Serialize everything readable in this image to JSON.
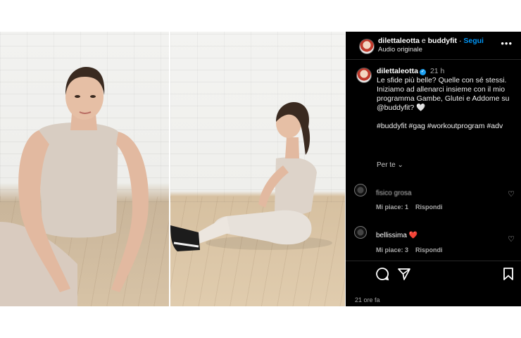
{
  "header": {
    "user1": "dilettaleotta",
    "conj": "e",
    "user2": "buddyfit",
    "sep": "·",
    "follow": "Segui",
    "audio": "Audio originale",
    "more_icon": "more-icon"
  },
  "caption": {
    "username": "dilettaleotta",
    "time": "21 h",
    "line1": "Le sfide più belle? Quelle con sé stessi.",
    "line2": "Iniziamo ad allenarci insieme con il mio programma Gambe, Glutei e Addome su @buddyfit? 🤍",
    "line3": "#buddyfit #gag #workoutprogram #adv",
    "translate": "Per te",
    "verified_icon": "verified-icon"
  },
  "comments": [
    {
      "user": "",
      "text": "fisico grosa",
      "likes": "Mi piace: 1",
      "reply": "Rispondi"
    },
    {
      "user": "",
      "text": "bellissima ❤️",
      "likes": "Mi piace: 3",
      "reply": "Rispondi"
    }
  ],
  "actions": {
    "comment_icon": "comment-icon",
    "share_icon": "share-icon",
    "save_icon": "bookmark-icon"
  },
  "date": "21 ore fa",
  "colors": {
    "panel_bg": "#000000",
    "follow": "#0095f6",
    "muted": "#a8a8a8"
  }
}
